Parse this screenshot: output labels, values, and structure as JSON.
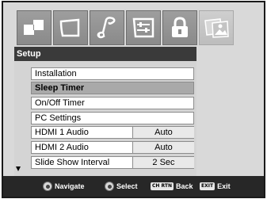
{
  "menu": {
    "title": "Setup",
    "items": [
      {
        "label": "Installation"
      },
      {
        "label": "Sleep Timer",
        "selected": true
      },
      {
        "label": "On/Off Timer"
      },
      {
        "label": "PC Settings"
      },
      {
        "label": "HDMI 1 Audio",
        "value": "Auto"
      },
      {
        "label": "HDMI 2 Audio",
        "value": "Auto"
      },
      {
        "label": "Slide Show Interval",
        "value": "2 Sec"
      }
    ]
  },
  "tabs": [
    {
      "icon": "picture-icon"
    },
    {
      "icon": "screen-icon"
    },
    {
      "icon": "music-note-icon"
    },
    {
      "icon": "setup-sliders-icon"
    },
    {
      "icon": "lock-icon"
    },
    {
      "icon": "photo-viewer-icon",
      "active": false
    }
  ],
  "nav": {
    "navigate_label": "Navigate",
    "select_label": "Select",
    "back_key": "CH RTN",
    "back_label": "Back",
    "exit_key": "EXIT",
    "exit_label": "Exit"
  },
  "colors": {
    "title_bar": "#3a3a3a",
    "selected_row": "#a9a9a9",
    "nav_bar": "#272727",
    "screen_bg": "#d9d9d9"
  }
}
